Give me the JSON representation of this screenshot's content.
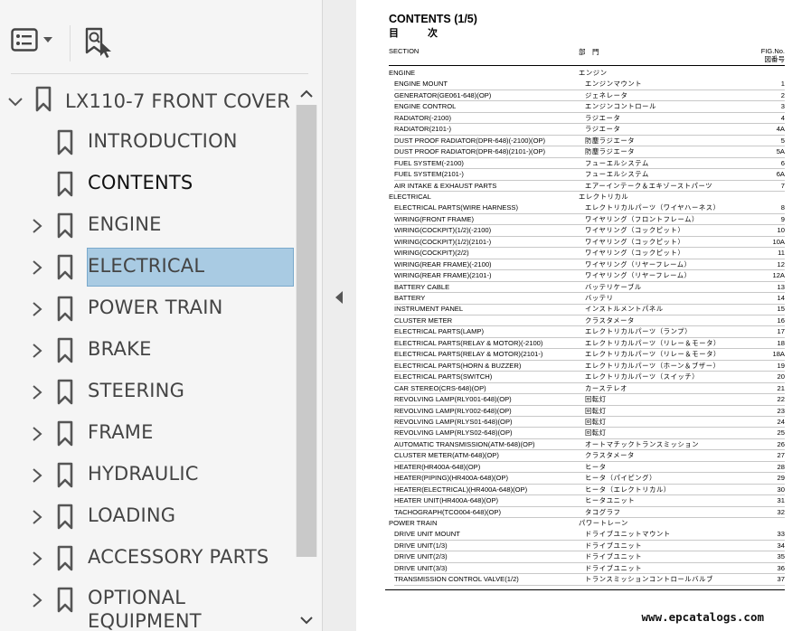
{
  "sidebar": {
    "toolbar": {
      "options_icon": "list-options-icon",
      "find_icon": "find-bookmark-icon"
    },
    "root": {
      "label": "LX110-7 FRONT COVER"
    },
    "items": [
      {
        "label": "INTRODUCTION",
        "has_children": false
      },
      {
        "label": "CONTENTS",
        "has_children": false,
        "selected": true
      },
      {
        "label": "ENGINE",
        "has_children": true
      },
      {
        "label": "ELECTRICAL",
        "has_children": true
      },
      {
        "label": "POWER TRAIN",
        "has_children": true
      },
      {
        "label": "BRAKE",
        "has_children": true
      },
      {
        "label": "STEERING",
        "has_children": true
      },
      {
        "label": "FRAME",
        "has_children": true
      },
      {
        "label": "HYDRAULIC",
        "has_children": true
      },
      {
        "label": "LOADING",
        "has_children": true
      },
      {
        "label": "ACCESSORY PARTS",
        "has_children": true
      },
      {
        "label": "OPTIONAL EQUIPMENT",
        "has_children": true
      }
    ]
  },
  "document": {
    "title": "CONTENTS (1/5)",
    "title_jp": "目次",
    "header_section": "SECTION",
    "header_jp": "部　門",
    "header_fig": "FIG.No.",
    "header_fig_jp": "図番号",
    "rows": [
      {
        "type": "sec",
        "en": "ENGINE",
        "jp": "エンジン",
        "no": ""
      },
      {
        "en": "ENGINE MOUNT",
        "jp": "エンジンマウント",
        "no": "1"
      },
      {
        "en": "GENERATOR(GE061-648)(OP)",
        "jp": "ジェネレータ",
        "no": "2"
      },
      {
        "en": "ENGINE CONTROL",
        "jp": "エンジンコントロール",
        "no": "3"
      },
      {
        "en": "RADIATOR(-2100)",
        "jp": "ラジエータ",
        "no": "4"
      },
      {
        "en": "RADIATOR(2101-)",
        "jp": "ラジエータ",
        "no": "4A"
      },
      {
        "en": "DUST PROOF RADIATOR(DPR-648)(-2100)(OP)",
        "jp": "防塵ラジエータ",
        "no": "5"
      },
      {
        "en": "DUST PROOF RADIATOR(DPR-648)(2101-)(OP)",
        "jp": "防塵ラジエータ",
        "no": "5A"
      },
      {
        "en": "FUEL SYSTEM(-2100)",
        "jp": "フューエルシステム",
        "no": "6"
      },
      {
        "en": "FUEL SYSTEM(2101-)",
        "jp": "フューエルシステム",
        "no": "6A"
      },
      {
        "en": "AIR INTAKE & EXHAUST PARTS",
        "jp": "エアーインテーク＆エキゾーストパーツ",
        "no": "7"
      },
      {
        "type": "sec",
        "en": "ELECTRICAL",
        "jp": "エレクトリカル",
        "no": ""
      },
      {
        "en": "ELECTRICAL PARTS(WIRE HARNESS)",
        "jp": "エレクトリカルパーツ（ワイヤハーネス）",
        "no": "8"
      },
      {
        "en": "WIRING(FRONT FRAME)",
        "jp": "ワイヤリング（フロントフレーム）",
        "no": "9"
      },
      {
        "en": "WIRING(COCKPIT)(1/2)(-2100)",
        "jp": "ワイヤリング（コックピット）",
        "no": "10"
      },
      {
        "en": "WIRING(COCKPIT)(1/2)(2101-)",
        "jp": "ワイヤリング（コックピット）",
        "no": "10A"
      },
      {
        "en": "WIRING(COCKPIT)(2/2)",
        "jp": "ワイヤリング（コックピット）",
        "no": "11"
      },
      {
        "en": "WIRING(REAR FRAME)(-2100)",
        "jp": "ワイヤリング（リヤーフレーム）",
        "no": "12"
      },
      {
        "en": "WIRING(REAR FRAME)(2101-)",
        "jp": "ワイヤリング（リヤーフレーム）",
        "no": "12A"
      },
      {
        "en": "BATTERY CABLE",
        "jp": "バッテリケーブル",
        "no": "13"
      },
      {
        "en": "BATTERY",
        "jp": "バッテリ",
        "no": "14"
      },
      {
        "en": "INSTRUMENT PANEL",
        "jp": "インストルメントパネル",
        "no": "15"
      },
      {
        "en": "CLUSTER METER",
        "jp": "クラスタメータ",
        "no": "16"
      },
      {
        "en": "ELECTRICAL PARTS(LAMP)",
        "jp": "エレクトリカルパーツ（ランプ）",
        "no": "17"
      },
      {
        "en": "ELECTRICAL PARTS(RELAY & MOTOR)(-2100)",
        "jp": "エレクトリカルパーツ（リレー＆モータ）",
        "no": "18"
      },
      {
        "en": "ELECTRICAL PARTS(RELAY & MOTOR)(2101-)",
        "jp": "エレクトリカルパーツ（リレー＆モータ）",
        "no": "18A"
      },
      {
        "en": "ELECTRICAL PARTS(HORN & BUZZER)",
        "jp": "エレクトリカルパーツ（ホーン＆ブザー）",
        "no": "19"
      },
      {
        "en": "ELECTRICAL PARTS(SWITCH)",
        "jp": "エレクトリカルパーツ（スイッチ）",
        "no": "20"
      },
      {
        "en": "CAR STEREO(CRS-648)(OP)",
        "jp": "カーステレオ",
        "no": "21"
      },
      {
        "en": "REVOLVING LAMP(RLY001-648)(OP)",
        "jp": "回転灯",
        "no": "22"
      },
      {
        "en": "REVOLVING LAMP(RLY002-648)(OP)",
        "jp": "回転灯",
        "no": "23"
      },
      {
        "en": "REVOLVING LAMP(RLYS01-648)(OP)",
        "jp": "回転灯",
        "no": "24"
      },
      {
        "en": "REVOLVING LAMP(RLYS02-648)(OP)",
        "jp": "回転灯",
        "no": "25"
      },
      {
        "en": "AUTOMATIC TRANSMISSION(ATM-648)(OP)",
        "jp": "オートマチックトランスミッション",
        "no": "26"
      },
      {
        "en": "CLUSTER METER(ATM-648)(OP)",
        "jp": "クラスタメータ",
        "no": "27"
      },
      {
        "en": "HEATER(HR400A-648)(OP)",
        "jp": "ヒータ",
        "no": "28"
      },
      {
        "en": "HEATER(PIPING)(HR400A-648)(OP)",
        "jp": "ヒータ（パイピング）",
        "no": "29"
      },
      {
        "en": "HEATER(ELECTRICAL)(HR400A-648)(OP)",
        "jp": "ヒータ（エレクトリカル）",
        "no": "30"
      },
      {
        "en": "HEATER UNIT(HR400A-648)(OP)",
        "jp": "ヒータユニット",
        "no": "31"
      },
      {
        "en": "TACHOGRAPH(TCO004-648)(OP)",
        "jp": "タコグラフ",
        "no": "32"
      },
      {
        "type": "sec",
        "en": "POWER TRAIN",
        "jp": "パワートレーン",
        "no": ""
      },
      {
        "en": "DRIVE UNIT MOUNT",
        "jp": "ドライブユニットマウント",
        "no": "33"
      },
      {
        "en": "DRIVE UNIT(1/3)",
        "jp": "ドライブユニット",
        "no": "34"
      },
      {
        "en": "DRIVE UNIT(2/3)",
        "jp": "ドライブユニット",
        "no": "35"
      },
      {
        "en": "DRIVE UNIT(3/3)",
        "jp": "ドライブユニット",
        "no": "36"
      },
      {
        "en": "TRANSMISSION CONTROL VALVE(1/2)",
        "jp": "トランスミッションコントロールバルブ",
        "no": "37"
      }
    ]
  },
  "watermark": "www.epcatalogs.com"
}
